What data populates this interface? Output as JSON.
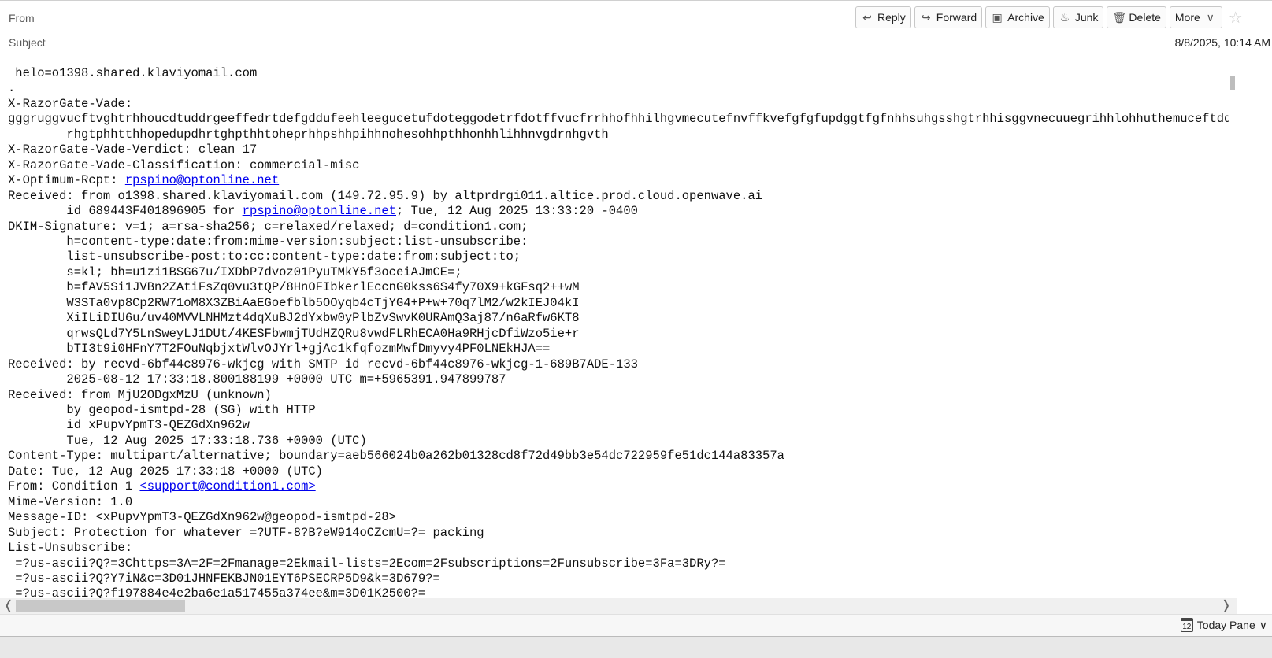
{
  "header": {
    "from_label": "From",
    "subject_label": "Subject",
    "date": "8/8/2025, 10:14 AM",
    "buttons": [
      {
        "label": "Reply",
        "icon": "reply-icon",
        "glyph": "↩"
      },
      {
        "label": "Forward",
        "icon": "forward-icon",
        "glyph": "↪"
      },
      {
        "label": "Archive",
        "icon": "archive-icon",
        "glyph": "▣"
      },
      {
        "label": "Junk",
        "icon": "junk-icon",
        "glyph": "♨"
      },
      {
        "label": "Delete",
        "icon": "trash-icon",
        "glyph": "🗑"
      },
      {
        "label": "More",
        "icon": "chevron-down-icon",
        "glyph": "∨"
      }
    ],
    "star_glyph": "☆"
  },
  "source_lines": [
    [
      {
        "t": " helo=o1398.shared.klaviyomail.com"
      }
    ],
    [
      {
        "t": "."
      }
    ],
    [
      {
        "t": "X-RazorGate-Vade:"
      }
    ],
    [
      {
        "t": "gggruggvucftvghtrhhoucdtuddrgeeffedrtdefgddufeehleegucetufdoteggodetrfdotffvucfrrhhofhhilhgvmecutefnvffkvefgfgfupdggtfgfnhhsuhgsshgtrhhisggvnecuuegrihhlohhuthemuceftddtnecunecujfgurhepkfffgggfuffvfhfhjggtgfesthejredttdefjeenucfhrhhomhepvehonhguihhtihhonhculhculhhuphhpohhrthestghonhguihhtihhonhdurdgtohhmqeenucggtffrrghtthgvrhhnpeffvdfggfeivdeh"
      }
    ],
    [
      {
        "t": "        rhgtphhtthhopedupdhrtghpthhtoheprhhpshhpihhnohesohhpthhonhhlihhnvgdrnhgvth"
      }
    ],
    [
      {
        "t": "X-RazorGate-Vade-Verdict: clean 17"
      }
    ],
    [
      {
        "t": "X-RazorGate-Vade-Classification: commercial-misc"
      }
    ],
    [
      {
        "t": "X-Optimum-Rcpt: "
      },
      {
        "t": "rpspino@optonline.net",
        "link": true
      }
    ],
    [
      {
        "t": "Received: from o1398.shared.klaviyomail.com (149.72.95.9) by altprdrgi011.altice.prod.cloud.openwave.ai"
      }
    ],
    [
      {
        "t": "        id 689443F401896905 for "
      },
      {
        "t": "rpspino@optonline.net",
        "link": true
      },
      {
        "t": "; Tue, 12 Aug 2025 13:33:20 -0400"
      }
    ],
    [
      {
        "t": "DKIM-Signature: v=1; a=rsa-sha256; c=relaxed/relaxed; d=condition1.com;"
      }
    ],
    [
      {
        "t": "        h=content-type:date:from:mime-version:subject:list-unsubscribe:"
      }
    ],
    [
      {
        "t": "        list-unsubscribe-post:to:cc:content-type:date:from:subject:to;"
      }
    ],
    [
      {
        "t": "        s=kl; bh=u1zi1BSG67u/IXDbP7dvoz01PyuTMkY5f3oceiAJmCE=;"
      }
    ],
    [
      {
        "t": "        b=fAV5Si1JVBn2ZAtiFsZq0vu3tQP/8HnOFIbkerlEccnG0kss6S4fy70X9+kGFsq2++wM"
      }
    ],
    [
      {
        "t": "        W3STa0vp8Cp2RW71oM8X3ZBiAaEGoefblb5OOyqb4cTjYG4+P+w+70q7lM2/w2kIEJ04kI"
      }
    ],
    [
      {
        "t": "        XiILiDIU6u/uv40MVVLNHMzt4dqXuBJ2dYxbw0yPlbZvSwvK0URAmQ3aj87/n6aRfw6KT8"
      }
    ],
    [
      {
        "t": "        qrwsQLd7Y5LnSweyLJ1DUt/4KESFbwmjTUdHZQRu8vwdFLRhECA0Ha9RHjcDfiWzo5ie+r"
      }
    ],
    [
      {
        "t": "        bTI3t9i0HFnY7T2FOuNqbjxtWlvOJYrl+gjAc1kfqfozmMwfDmyvy4PF0LNEkHJA=="
      }
    ],
    [
      {
        "t": "Received: by recvd-6bf44c8976-wkjcg with SMTP id recvd-6bf44c8976-wkjcg-1-689B7ADE-133"
      }
    ],
    [
      {
        "t": "        2025-08-12 17:33:18.800188199 +0000 UTC m=+5965391.947899787"
      }
    ],
    [
      {
        "t": "Received: from MjU2ODgxMzU (unknown)"
      }
    ],
    [
      {
        "t": "        by geopod-ismtpd-28 (SG) with HTTP"
      }
    ],
    [
      {
        "t": "        id xPupvYpmT3-QEZGdXn962w"
      }
    ],
    [
      {
        "t": "        Tue, 12 Aug 2025 17:33:18.736 +0000 (UTC)"
      }
    ],
    [
      {
        "t": "Content-Type: multipart/alternative; boundary=aeb566024b0a262b01328cd8f72d49bb3e54dc722959fe51dc144a83357a"
      }
    ],
    [
      {
        "t": "Date: Tue, 12 Aug 2025 17:33:18 +0000 (UTC)"
      }
    ],
    [
      {
        "t": "From: Condition 1 "
      },
      {
        "t": "<support@condition1.com>",
        "link": true
      }
    ],
    [
      {
        "t": "Mime-Version: 1.0"
      }
    ],
    [
      {
        "t": "Message-ID: <xPupvYpmT3-QEZGdXn962w@geopod-ismtpd-28>"
      }
    ],
    [
      {
        "t": "Subject: Protection for whatever =?UTF-8?B?eW914oCZcmU=?= packing"
      }
    ],
    [
      {
        "t": "List-Unsubscribe:"
      }
    ],
    [
      {
        "t": " =?us-ascii?Q?=3Chttps=3A=2F=2Fmanage=2Ekmail-lists=2Ecom=2Fsubscriptions=2Funsubscribe=3Fa=3DRy?="
      }
    ],
    [
      {
        "t": " =?us-ascii?Q?Y7iN&c=3D01JHNFEKBJN01EYT6PSECRP5D9&k=3D679?="
      }
    ],
    [
      {
        "t": " =?us-ascii?Q?f197884e4e2ba6e1a517455a374ee&m=3D01K2500?="
      }
    ]
  ],
  "status_bar": {
    "today_pane_label": "Today Pane",
    "calendar_day": "12",
    "chevron_glyph": "∨"
  },
  "scrollbar": {
    "left_arrow": "❬",
    "right_arrow": "❭"
  }
}
